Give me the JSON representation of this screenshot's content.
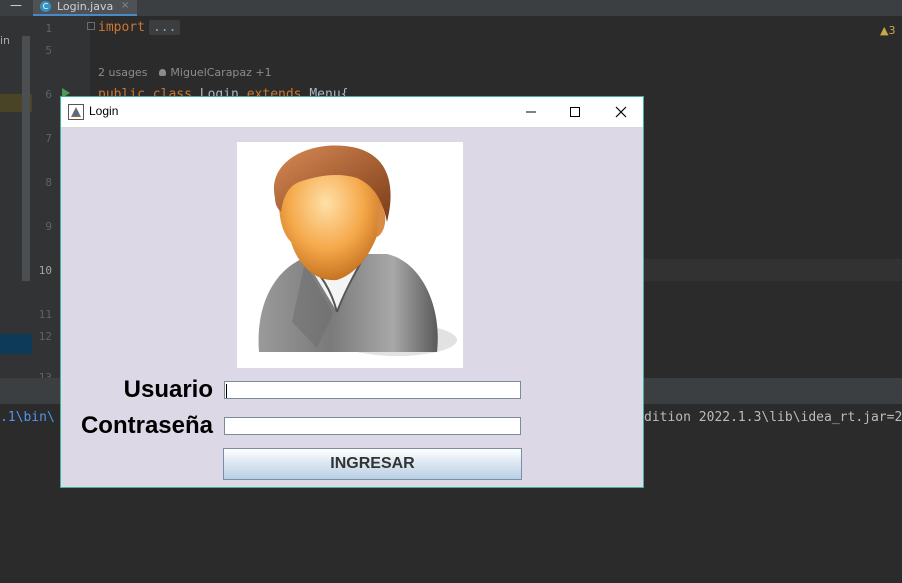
{
  "ide": {
    "tab_label": "Login.java",
    "tab_close": "×",
    "tab_menu_glyph": "—",
    "left_label": "in",
    "line_numbers": [
      "1",
      "5",
      "6",
      "7",
      "8",
      "9",
      "10",
      "11",
      "12",
      "13"
    ],
    "code": {
      "import_kw": "import",
      "import_fold": "...",
      "usages": "2 usages",
      "author": "MiguelCarapaz +1",
      "class_line_kw1": "public class",
      "class_name": "Login",
      "extends_kw": "extends",
      "parent": "Menu{"
    },
    "warning_count": "3",
    "console": {
      "left_text": ".1\\bin\\",
      "right_text": "dition 2022.1.3\\lib\\idea_rt.jar=2"
    },
    "colors": {
      "background": "#2b2b2b",
      "keyword": "#cc7832",
      "link": "#5394ec"
    }
  },
  "login_window": {
    "title": "Login",
    "controls": {
      "minimize": "minimize-icon",
      "maximize": "maximize-icon",
      "close": "close-icon"
    },
    "avatar": "user-avatar-image",
    "form": {
      "usuario_label": "Usuario",
      "usuario_value": "",
      "contrasena_label": "Contraseña",
      "contrasena_value": ""
    },
    "submit_label": "INGRESAR",
    "colors": {
      "window_bg": "#dcd8e6",
      "border": "#3fb3a0"
    }
  }
}
